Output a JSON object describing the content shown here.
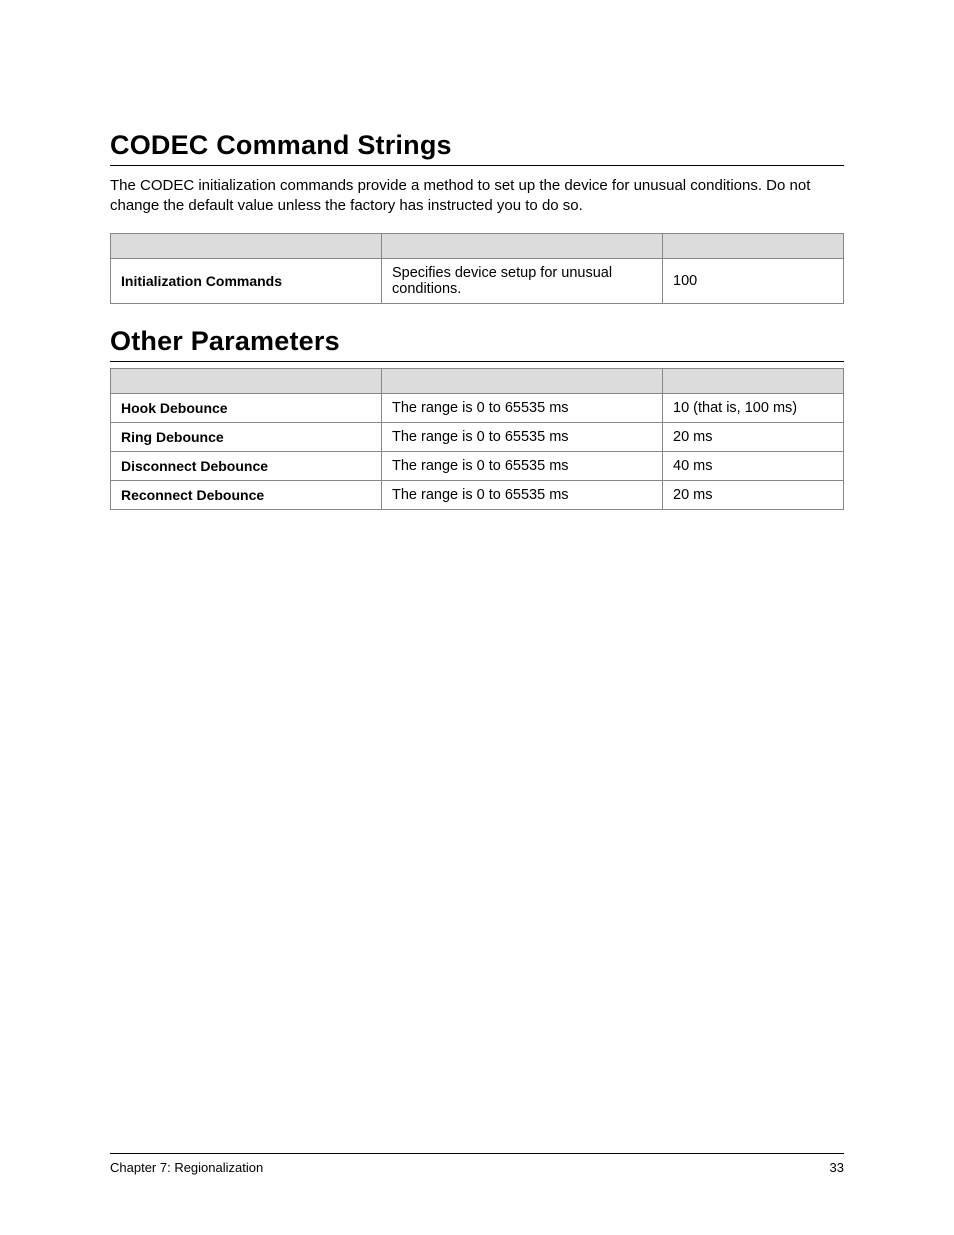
{
  "section1": {
    "title": "CODEC Command Strings",
    "paragraph": "The CODEC initialization commands provide a method to set up the device for unusual conditions. Do not change the default value unless the factory has instructed you to do so.",
    "rows": [
      {
        "label": "Initialization Commands",
        "desc": "Specifies device setup for unusual conditions.",
        "value": "100"
      }
    ]
  },
  "section2": {
    "title": "Other Parameters",
    "rows": [
      {
        "label": "Hook Debounce",
        "desc": "The range is 0 to 65535 ms",
        "value": "10 (that is, 100 ms)"
      },
      {
        "label": "Ring Debounce",
        "desc": "The range is 0 to 65535 ms",
        "value": "20 ms"
      },
      {
        "label": "Disconnect Debounce",
        "desc": "The range is 0 to 65535 ms",
        "value": "40 ms"
      },
      {
        "label": "Reconnect Debounce",
        "desc": "The range is 0 to 65535 ms",
        "value": "20 ms"
      }
    ]
  },
  "footer": {
    "left": "Chapter 7:  Regionalization",
    "right": "33"
  }
}
